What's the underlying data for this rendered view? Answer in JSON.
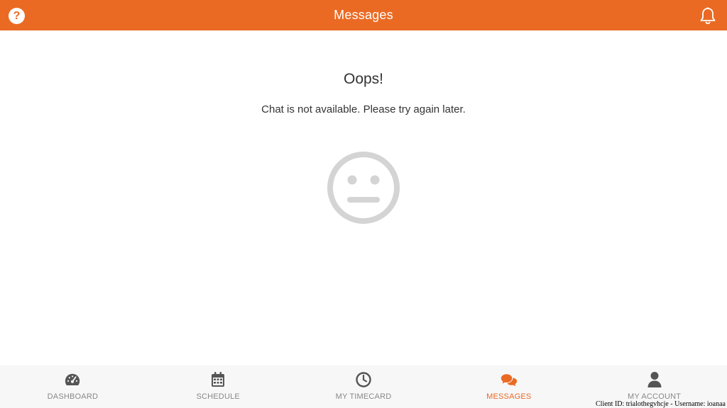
{
  "header": {
    "title": "Messages",
    "help_icon": "question-circle-icon",
    "bell_icon": "bell-icon"
  },
  "main": {
    "heading": "Oops!",
    "message": "Chat is not available. Please try again later.",
    "face_icon": "neutral-face-icon"
  },
  "bottom_nav": {
    "items": [
      {
        "label": "DASHBOARD",
        "icon": "gauge-icon",
        "active": false
      },
      {
        "label": "SCHEDULE",
        "icon": "calendar-icon",
        "active": false
      },
      {
        "label": "MY TIMECARD",
        "icon": "clock-icon",
        "active": false
      },
      {
        "label": "MESSAGES",
        "icon": "chat-bubbles-icon",
        "active": true
      },
      {
        "label": "MY ACCOUNT",
        "icon": "user-icon",
        "active": false
      }
    ]
  },
  "footer": {
    "note": "Client ID: trialothegvhcje - Username: ioanaa"
  },
  "colors": {
    "accent": "#ea6a23",
    "nav_icon": "#555555",
    "nav_label": "#888888",
    "face": "#d4d4d4"
  }
}
